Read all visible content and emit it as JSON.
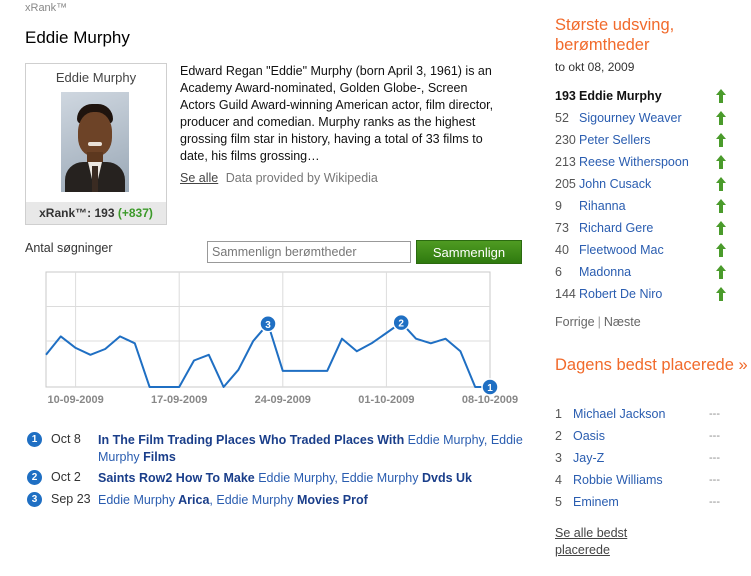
{
  "brand": "xRank™",
  "celebrity": {
    "name": "Eddie Murphy",
    "card_name": "Eddie Murphy",
    "xrank_label": "xRank™: 193",
    "xrank_delta": "(+837)",
    "bio": "Edward Regan \"Eddie\" Murphy (born April 3, 1961) is an Academy Award-nominated, Golden Globe-, Screen Actors Guild Award-winning American actor, film director, producer and comedian. Murphy ranks as the highest grossing film star in history, having a total of 33 films to date, his films grossing…",
    "see_all": "Se alle",
    "provided_by": "Data provided by Wikipedia"
  },
  "compare": {
    "searches_label": "Antal søgninger",
    "placeholder": "Sammenlign berømtheder",
    "button": "Sammenlign"
  },
  "chart_data": {
    "type": "line",
    "x": [
      "2009-09-08",
      "2009-09-09",
      "2009-09-10",
      "2009-09-11",
      "2009-09-12",
      "2009-09-13",
      "2009-09-14",
      "2009-09-15",
      "2009-09-16",
      "2009-09-17",
      "2009-09-18",
      "2009-09-19",
      "2009-09-20",
      "2009-09-21",
      "2009-09-22",
      "2009-09-23",
      "2009-09-24",
      "2009-09-25",
      "2009-09-26",
      "2009-09-27",
      "2009-09-28",
      "2009-09-29",
      "2009-09-30",
      "2009-10-01",
      "2009-10-02",
      "2009-10-03",
      "2009-10-04",
      "2009-10-05",
      "2009-10-06",
      "2009-10-07",
      "2009-10-08"
    ],
    "values": [
      28,
      44,
      34,
      28,
      33,
      44,
      38,
      0,
      0,
      0,
      23,
      28,
      0,
      15,
      40,
      55,
      14,
      14,
      14,
      14,
      42,
      31,
      38,
      47,
      56,
      42,
      38,
      42,
      31,
      0,
      0
    ],
    "ylim": [
      0,
      100
    ],
    "x_tick_labels": [
      "10-09-2009",
      "17-09-2009",
      "24-09-2009",
      "01-10-2009",
      "08-10-2009"
    ],
    "grid": true,
    "markers": [
      {
        "label": "3",
        "x": "2009-09-23"
      },
      {
        "label": "2",
        "x": "2009-10-02"
      },
      {
        "label": "1",
        "x": "2009-10-08"
      }
    ],
    "line_color": "#1f6fc3"
  },
  "events": [
    {
      "marker": "1",
      "date": "Oct 8",
      "parts": [
        {
          "text": "In The Film Trading Places Who Traded Places With",
          "bold": true
        },
        {
          "text": " Eddie Murphy, Eddie Murphy",
          "bold": false
        },
        {
          "text": " Films",
          "bold": true
        }
      ]
    },
    {
      "marker": "2",
      "date": "Oct 2",
      "parts": [
        {
          "text": "Saints Row2 How To Make",
          "bold": true
        },
        {
          "text": " Eddie Murphy, Eddie Murphy",
          "bold": false
        },
        {
          "text": " Dvds Uk",
          "bold": true
        }
      ]
    },
    {
      "marker": "3",
      "date": "Sep 23",
      "parts": [
        {
          "text": "Eddie Murphy",
          "bold": false
        },
        {
          "text": " Arica",
          "bold": true
        },
        {
          "text": ", Eddie Murphy",
          "bold": false
        },
        {
          "text": " Movies Prof",
          "bold": true
        }
      ]
    }
  ],
  "movers": {
    "title": "Største udsving, berømtheder",
    "subtitle": "to okt 08, 2009",
    "items": [
      {
        "rank": "193",
        "name": "Eddie Murphy"
      },
      {
        "rank": "52",
        "name": "Sigourney Weaver"
      },
      {
        "rank": "230",
        "name": "Peter Sellers"
      },
      {
        "rank": "213",
        "name": "Reese Witherspoon"
      },
      {
        "rank": "205",
        "name": "John Cusack"
      },
      {
        "rank": "9",
        "name": "Rihanna"
      },
      {
        "rank": "73",
        "name": "Richard Gere"
      },
      {
        "rank": "40",
        "name": "Fleetwood Mac"
      },
      {
        "rank": "6",
        "name": "Madonna"
      },
      {
        "rank": "144",
        "name": "Robert De Niro"
      }
    ],
    "arrow_icon": "up-arrow-icon",
    "arrow_color": "#4a9b2b",
    "prev": "Forrige",
    "separator": "|",
    "next": "Næste"
  },
  "top_today": {
    "title": "Dagens bedst placerede »",
    "items": [
      {
        "rank": "1",
        "name": "Michael Jackson",
        "change": "---"
      },
      {
        "rank": "2",
        "name": "Oasis",
        "change": "---"
      },
      {
        "rank": "3",
        "name": "Jay-Z",
        "change": "---"
      },
      {
        "rank": "4",
        "name": "Robbie Williams",
        "change": "---"
      },
      {
        "rank": "5",
        "name": "Eminem",
        "change": "---"
      }
    ],
    "see_all": "Se alle bedst placerede"
  }
}
